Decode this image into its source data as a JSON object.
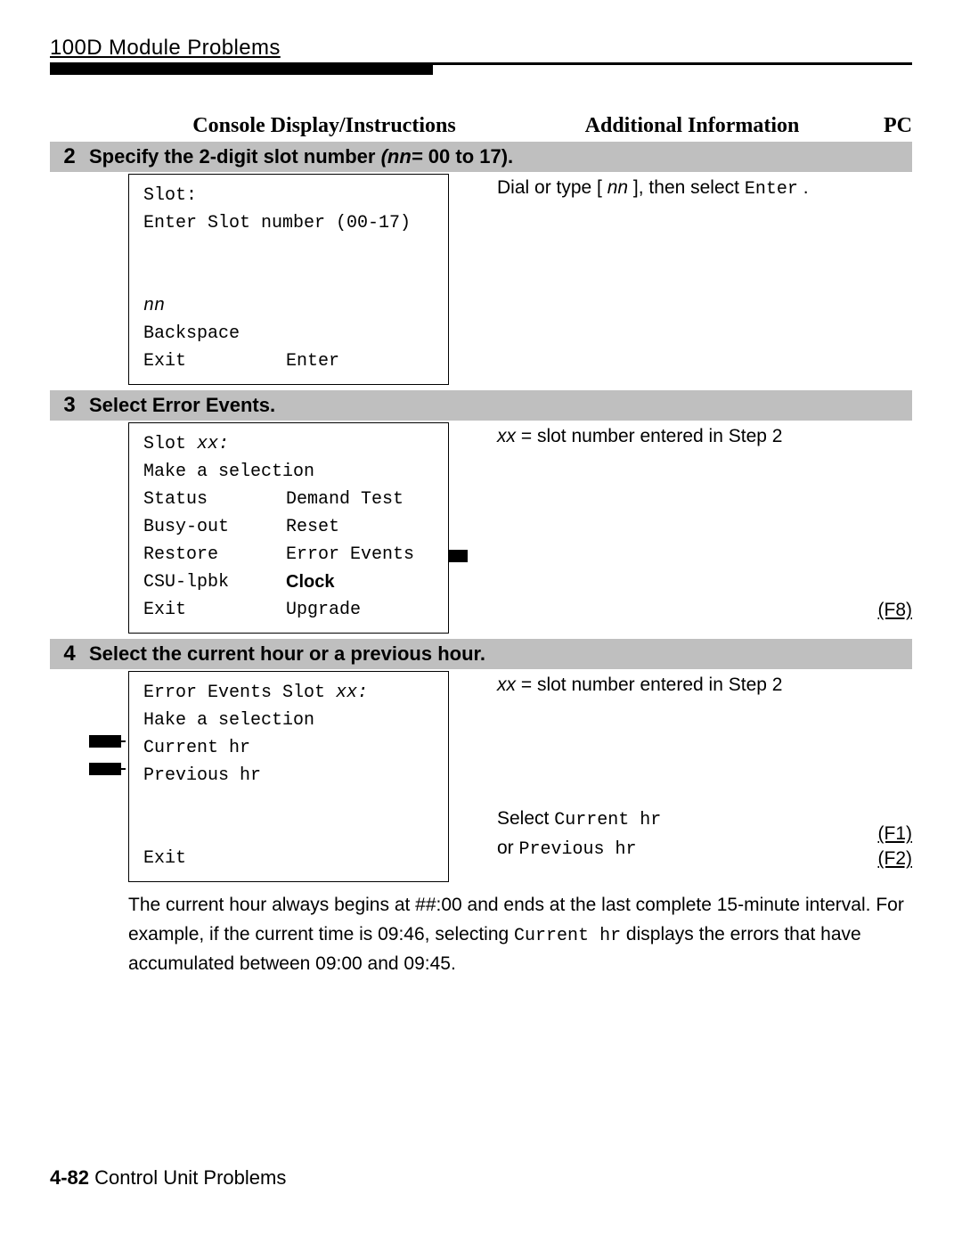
{
  "header": {
    "running_head": "100D Module Problems"
  },
  "headings": {
    "console": "Console Display/Instructions",
    "additional": "Additional Information",
    "pc": "PC"
  },
  "steps": [
    {
      "number": "2",
      "title_a": "Specify the 2-digit slot number ",
      "title_param": "(nn=",
      "title_b": " 00 to 17).",
      "console": {
        "0": "Slot:",
        "1": "Enter Slot number (00-17)",
        "2": "nn",
        "3": "Backspace",
        "4a": "Exit",
        "4b": "Enter"
      },
      "info": {
        "a": "Dial or type [ ",
        "nn": "nn",
        "b": " ], then select ",
        "enter": "Enter",
        "c": "."
      }
    },
    {
      "number": "3",
      "title": "Select Error Events.",
      "console": {
        "0a": "Slot ",
        "0b": "xx:",
        "1": "Make a selection",
        "2a": "Status",
        "2b": "Demand Test",
        "3a": "Busy-out",
        "3b": "Reset",
        "4a": "Restore",
        "4b": "Error Events",
        "5a": "CSU-lpbk",
        "5b": "Clock",
        "6a": "Exit",
        "6b": "Upgrade"
      },
      "info": {
        "xx": "xx",
        "rest": " = slot number entered in Step 2"
      },
      "pc": [
        "(F8)"
      ]
    },
    {
      "number": "4",
      "title": "Select the current hour or a previous hour.",
      "console": {
        "0a": "Error Events Slot ",
        "0b": "xx:",
        "1": "Hake a selection",
        "2": "Current hr",
        "3": "Previous hr",
        "4": "Exit"
      },
      "info": {
        "xx": "xx",
        "rest": " = slot number entered in Step 2",
        "select_label": "Select ",
        "select_current": "Current hr",
        "or_label": "or ",
        "select_previous": "Previous hr"
      },
      "pc": [
        "(F1)",
        "(F2)"
      ]
    }
  ],
  "paragraph": {
    "a": "The current hour always begins at ##:00 and ends at the last complete 15-minute interval. For example, if the current time is 09:46, selecting ",
    "mono": "Current hr",
    "b": " displays the errors that have accumulated between 09:00 and 09:45."
  },
  "footer": {
    "page": "4-82 ",
    "section": "Control Unit Problems"
  }
}
